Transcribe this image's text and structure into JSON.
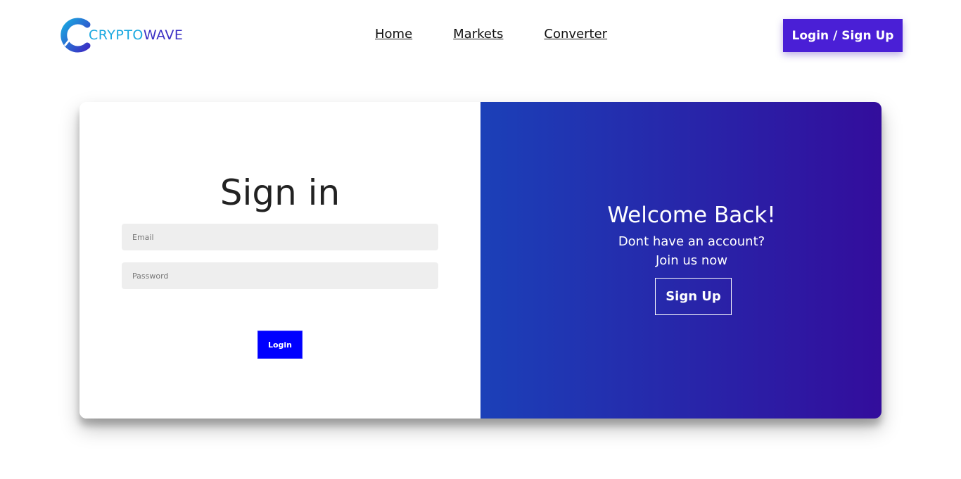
{
  "brand": {
    "name_part1": "CRYPTO",
    "name_part2": "WAVE"
  },
  "nav": {
    "links": [
      "Home",
      "Markets",
      "Converter"
    ],
    "cta_label": "Login / Sign Up"
  },
  "signin": {
    "title": "Sign in",
    "email_placeholder": "Email",
    "password_placeholder": "Password",
    "login_label": "Login"
  },
  "welcome": {
    "title": "Welcome Back!",
    "line1": "Dont have an account?",
    "line2": "Join us now",
    "signup_label": "Sign Up"
  },
  "colors": {
    "accent": "#4a1fd6",
    "login_button": "#0000ff",
    "gradient_start": "#1b40b8",
    "gradient_end": "#330d9c",
    "field_bg": "#eeeeee"
  },
  "icons": {
    "logo": "cryptowave-logo-icon"
  }
}
